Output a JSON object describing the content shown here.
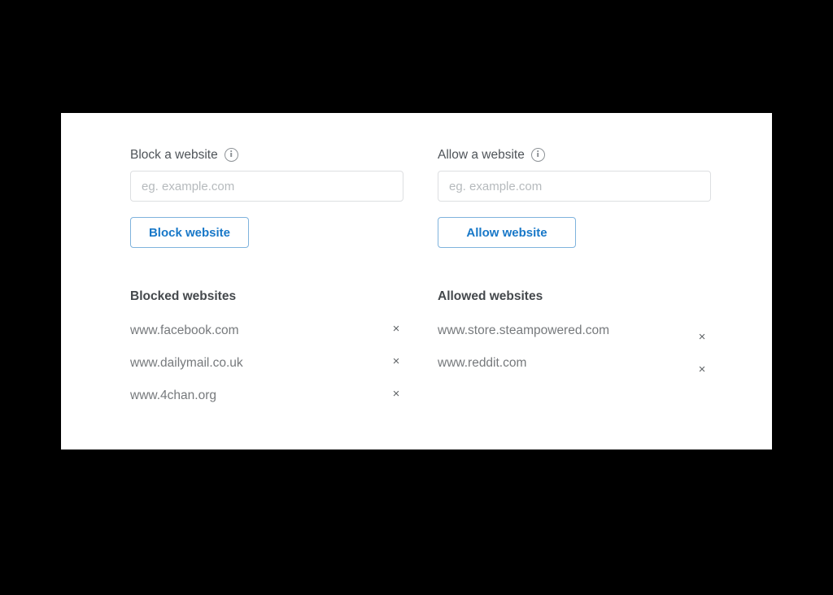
{
  "panel": {
    "block_section": {
      "label": "Block a website",
      "info_icon": "info-circle-icon",
      "input_placeholder": "eg. example.com",
      "input_value": "",
      "button_label": "Block website",
      "list_heading": "Blocked websites",
      "sites": [
        {
          "name": "www.facebook.com",
          "remove_icon": "close-icon"
        },
        {
          "name": "www.dailymail.co.uk",
          "remove_icon": "close-icon"
        },
        {
          "name": "www.4chan.org",
          "remove_icon": "close-icon"
        }
      ]
    },
    "allow_section": {
      "label": "Allow a website",
      "info_icon": "info-circle-icon",
      "input_placeholder": "eg. example.com",
      "input_value": "",
      "button_label": "Allow website",
      "list_heading": "Allowed websites",
      "sites": [
        {
          "name": "www.store.steampowered.com",
          "remove_icon": "close-icon"
        },
        {
          "name": "www.reddit.com",
          "remove_icon": "close-icon"
        }
      ]
    }
  },
  "colors": {
    "accent_blue": "#1878c8",
    "button_border": "#7fb3dd",
    "input_border": "#dddfe1",
    "heading_text": "#44484c",
    "body_text": "#76797c",
    "placeholder_text": "#b6babd",
    "panel_background": "#ffffff",
    "backdrop": "#000000"
  },
  "icon_glyphs": {
    "close": "×"
  }
}
